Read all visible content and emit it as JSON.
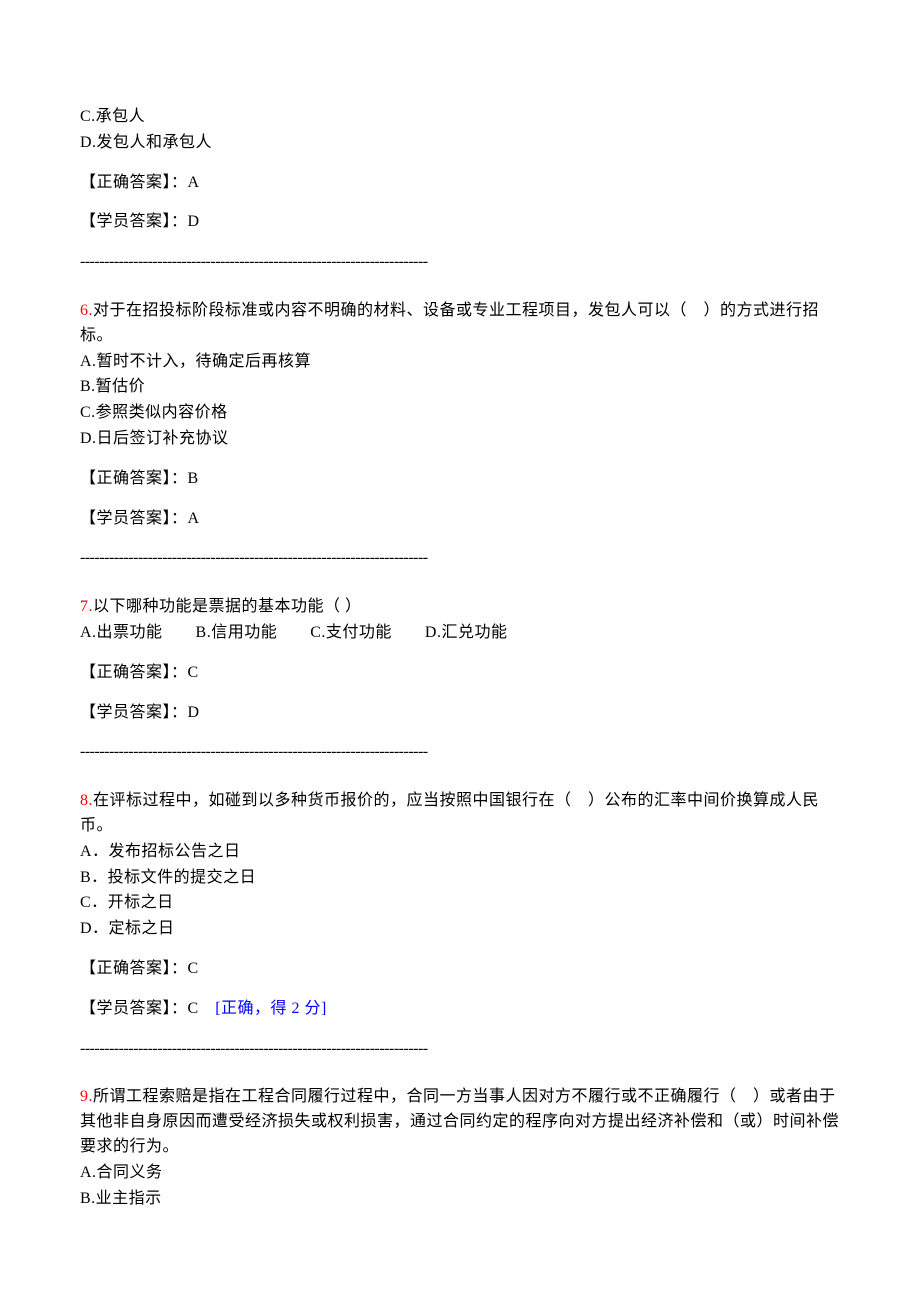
{
  "q5": {
    "optC": "C.承包人",
    "optD": "D.发包人和承包人",
    "correct_label": "【正确答案】：A",
    "student_label": "【学员答案】：D"
  },
  "sep": "------------------------------------------------------------------------",
  "q6": {
    "num": "6.",
    "text": "对于在招投标阶段标准或内容不明确的材料、设备或专业工程项目，发包人可以（　）的方式进行招标。",
    "optA": "A.暂时不计入，待确定后再核算",
    "optB": "B.暂估价",
    "optC": "C.参照类似内容价格",
    "optD": "D.日后签订补充协议",
    "correct_label": "【正确答案】：B",
    "student_label": "【学员答案】：A"
  },
  "q7": {
    "num": "7.",
    "text": "以下哪种功能是票据的基本功能（ ）",
    "opts": "A.出票功能　　B.信用功能　　C.支付功能　　D.汇兑功能",
    "correct_label": "【正确答案】：C",
    "student_label": "【学员答案】：D"
  },
  "q8": {
    "num": "8.",
    "text": "在评标过程中，如碰到以多种货币报价的，应当按照中国银行在（　）公布的汇率中间价换算成人民币。",
    "optA": "A．发布招标公告之日",
    "optB": "B．投标文件的提交之日",
    "optC": "C．开标之日",
    "optD": "D．定标之日",
    "correct_label": "【正确答案】：C",
    "student_label": "【学员答案】：C　",
    "student_mark": "[正确，得 2 分]"
  },
  "q9": {
    "num": "9.",
    "text": "所谓工程索赔是指在工程合同履行过程中，合同一方当事人因对方不履行或不正确履行（　）或者由于其他非自身原因而遭受经济损失或权利损害，通过合同约定的程序向对方提出经济补偿和（或）时间补偿要求的行为。",
    "optA": "A.合同义务",
    "optB": "B.业主指示"
  }
}
